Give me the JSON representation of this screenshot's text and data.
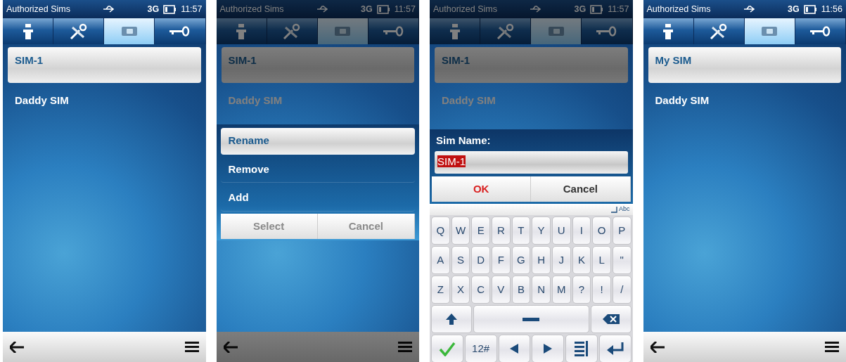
{
  "screens": [
    {
      "dimmed": false,
      "status": {
        "title": "Authorized Sims",
        "network": "3G",
        "time": "11:57"
      },
      "tabs": [
        {
          "kind": "info",
          "selected": false
        },
        {
          "kind": "tools",
          "selected": false
        },
        {
          "kind": "sim",
          "selected": true
        },
        {
          "kind": "key",
          "selected": false
        }
      ],
      "items": [
        {
          "label": "SIM-1",
          "selected": true
        },
        {
          "label": "Daddy SIM",
          "selected": false
        }
      ],
      "bottom_bar": true
    },
    {
      "dimmed": true,
      "status": {
        "title": "Authorized Sims",
        "network": "3G",
        "time": "11:57"
      },
      "tabs": [
        {
          "kind": "info",
          "selected": false
        },
        {
          "kind": "tools",
          "selected": false
        },
        {
          "kind": "sim",
          "selected": true
        },
        {
          "kind": "key",
          "selected": false
        }
      ],
      "items": [
        {
          "label": "SIM-1",
          "selected": true
        },
        {
          "label": "Daddy SIM",
          "selected": false
        }
      ],
      "bottom_bar": true,
      "menu": {
        "items": [
          {
            "label": "Rename",
            "selected": true
          },
          {
            "label": "Remove",
            "selected": false
          },
          {
            "label": "Add",
            "selected": false
          }
        ],
        "buttons": [
          {
            "label": "Select",
            "disabled": true
          },
          {
            "label": "Cancel",
            "disabled": true
          }
        ]
      }
    },
    {
      "dimmed": true,
      "status": {
        "title": "Authorized Sims",
        "network": "3G",
        "time": "11:57"
      },
      "tabs": [
        {
          "kind": "info",
          "selected": false
        },
        {
          "kind": "tools",
          "selected": false
        },
        {
          "kind": "sim",
          "selected": true
        },
        {
          "kind": "key",
          "selected": false
        }
      ],
      "items": [
        {
          "label": "SIM-1",
          "selected": true
        },
        {
          "label": "Daddy SIM",
          "selected": false
        }
      ],
      "bottom_bar": false,
      "dialog": {
        "label": "Sim Name:",
        "value": "SIM-1",
        "value_selected": true,
        "buttons": [
          {
            "label": "OK",
            "kind": "primary"
          },
          {
            "label": "Cancel",
            "kind": "normal"
          }
        ]
      },
      "keyboard": {
        "mode": "Abc",
        "letter_rows": [
          [
            {
              "kind": "char",
              "label": "Q"
            },
            {
              "kind": "char",
              "label": "W"
            },
            {
              "kind": "char",
              "label": "E"
            },
            {
              "kind": "char",
              "label": "R"
            },
            {
              "kind": "char",
              "label": "T"
            },
            {
              "kind": "char",
              "label": "Y"
            },
            {
              "kind": "char",
              "label": "U"
            },
            {
              "kind": "char",
              "label": "I"
            },
            {
              "kind": "char",
              "label": "O"
            },
            {
              "kind": "char",
              "label": "P"
            }
          ],
          [
            {
              "kind": "char",
              "label": "A"
            },
            {
              "kind": "char",
              "label": "S"
            },
            {
              "kind": "char",
              "label": "D"
            },
            {
              "kind": "char",
              "label": "F"
            },
            {
              "kind": "char",
              "label": "G"
            },
            {
              "kind": "char",
              "label": "H"
            },
            {
              "kind": "char",
              "label": "J"
            },
            {
              "kind": "char",
              "label": "K"
            },
            {
              "kind": "char",
              "label": "L"
            },
            {
              "kind": "char",
              "label": "\""
            }
          ],
          [
            {
              "kind": "char",
              "label": "Z"
            },
            {
              "kind": "char",
              "label": "X"
            },
            {
              "kind": "char",
              "label": "C"
            },
            {
              "kind": "char",
              "label": "V"
            },
            {
              "kind": "char",
              "label": "B"
            },
            {
              "kind": "char",
              "label": "N"
            },
            {
              "kind": "char",
              "label": "M"
            },
            {
              "kind": "char",
              "label": "?"
            },
            {
              "kind": "char",
              "label": "!"
            },
            {
              "kind": "char",
              "label": "/"
            }
          ]
        ],
        "control_keys": [
          {
            "kind": "shift"
          },
          {
            "kind": "space"
          },
          {
            "kind": "backspace"
          }
        ],
        "action_keys": [
          {
            "kind": "confirm"
          },
          {
            "kind": "text",
            "label": "12#"
          },
          {
            "kind": "left"
          },
          {
            "kind": "right"
          },
          {
            "kind": "list"
          },
          {
            "kind": "enter"
          }
        ]
      }
    },
    {
      "dimmed": false,
      "status": {
        "title": "Authorized Sims",
        "network": "3G",
        "time": "11:56"
      },
      "tabs": [
        {
          "kind": "info",
          "selected": false
        },
        {
          "kind": "tools",
          "selected": false
        },
        {
          "kind": "sim",
          "selected": true
        },
        {
          "kind": "key",
          "selected": false
        }
      ],
      "items": [
        {
          "label": "My SIM",
          "selected": true
        },
        {
          "label": "Daddy SIM",
          "selected": false
        }
      ],
      "bottom_bar": true
    }
  ]
}
